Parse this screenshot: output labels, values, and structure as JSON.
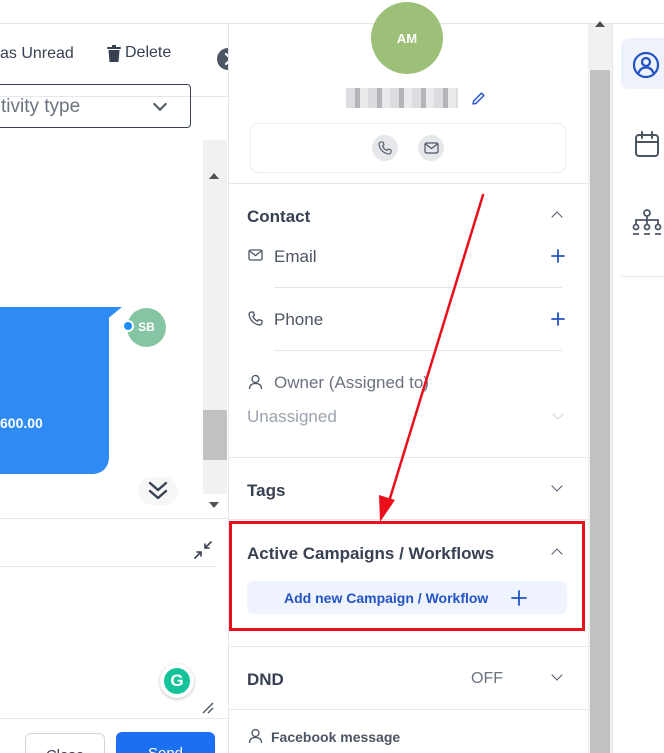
{
  "toolbar": {
    "mark_unread_label": "as Unread",
    "delete_label": "Delete"
  },
  "activity_filter": {
    "selected": "tivity type"
  },
  "conversation": {
    "bubble_amount": "600.00",
    "sender_initials": "SB"
  },
  "composer": {
    "close_label": "Close",
    "send_label": "Send"
  },
  "contact": {
    "avatar_initials": "AM",
    "section_title": "Contact",
    "email_label": "Email",
    "phone_label": "Phone",
    "owner_label": "Owner (Assigned to)",
    "owner_value": "Unassigned"
  },
  "tags": {
    "section_title": "Tags"
  },
  "campaigns": {
    "section_title": "Active Campaigns / Workflows",
    "add_label": "Add new Campaign / Workflow"
  },
  "dnd": {
    "section_title": "DND",
    "status": "OFF"
  },
  "channels": {
    "facebook_label": "Facebook message"
  },
  "colors": {
    "accent": "#2453c6",
    "highlight": "#ea0f1b",
    "bubble": "#2e8bf3",
    "send": "#1d6ff2"
  },
  "icons": [
    "trash-icon",
    "arrow-right-icon",
    "chevron-down-icon",
    "pencil-icon",
    "phone-icon",
    "mail-icon",
    "user-icon",
    "calendar-icon",
    "org-chart-icon",
    "plus-icon",
    "collapse-icon",
    "resize-icon",
    "grammarly-icon",
    "messenger-icon"
  ]
}
